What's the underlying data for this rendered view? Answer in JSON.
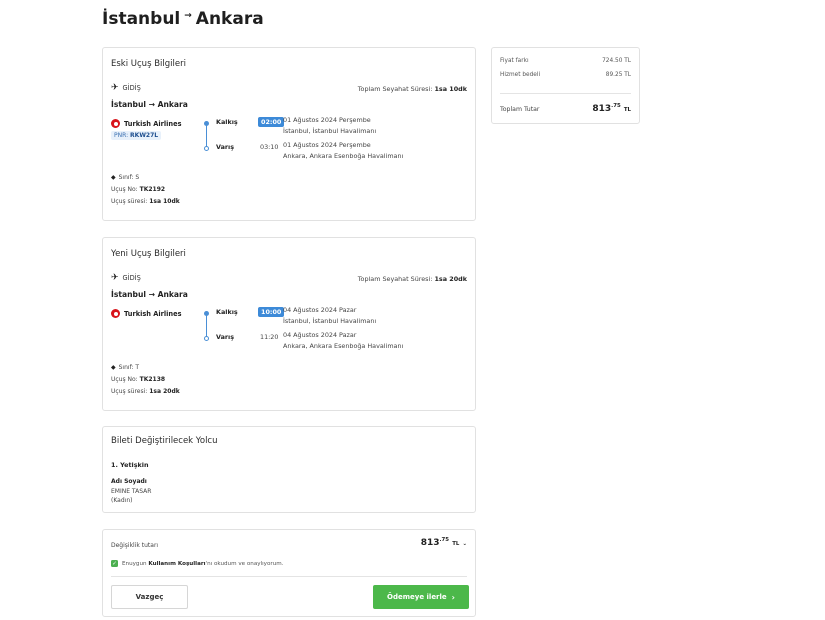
{
  "header": {
    "origin": "İstanbul",
    "arrow": "→",
    "destination": "Ankara"
  },
  "old_flight": {
    "title": "Eski Uçuş Bilgileri",
    "direction": "GİDİŞ",
    "route": "İstanbul → Ankara",
    "total_label": "Toplam Seyahat Süresi:",
    "total_value": "1sa 10dk",
    "airline": "Turkish Airlines",
    "pnr_label": "PNR:",
    "pnr_value": "RKW27L",
    "departure_label": "Kalkış",
    "departure_time": "02:00",
    "departure_date": "01 Ağustos 2024 Perşembe",
    "departure_airport": "İstanbul, İstanbul Havalimanı",
    "arrival_label": "Varış",
    "arrival_time": "03:10",
    "arrival_date": "01 Ağustos 2024 Perşembe",
    "arrival_airport": "Ankara, Ankara Esenboğa Havalimanı",
    "class_text": "Sınıf: S",
    "flight_no_label": "Uçuş No:",
    "flight_no": "TK2192",
    "duration_label": "Uçuş süresi:",
    "duration": "1sa 10dk"
  },
  "new_flight": {
    "title": "Yeni Uçuş Bilgileri",
    "direction": "GİDİŞ",
    "route": "İstanbul → Ankara",
    "total_label": "Toplam Seyahat Süresi:",
    "total_value": "1sa 20dk",
    "airline": "Turkish Airlines",
    "departure_label": "Kalkış",
    "departure_time": "10:00",
    "departure_date": "04 Ağustos 2024 Pazar",
    "departure_airport": "İstanbul, İstanbul Havalimanı",
    "arrival_label": "Varış",
    "arrival_time": "11:20",
    "arrival_date": "04 Ağustos 2024 Pazar",
    "arrival_airport": "Ankara, Ankara Esenboğa Havalimanı",
    "class_text": "Sınıf: T",
    "flight_no_label": "Uçuş No:",
    "flight_no": "TK2138",
    "duration_label": "Uçuş süresi:",
    "duration": "1sa 20dk"
  },
  "passenger": {
    "title": "Bileti Değiştirilecek Yolcu",
    "type": "1. Yetişkin",
    "name_label": "Adı Soyadı",
    "name": "EMINE TASAR",
    "gender": "(Kadın)"
  },
  "summary": {
    "fare_diff_label": "Fiyat farkı",
    "fare_diff_value": "724.50 TL",
    "service_fee_label": "Hizmet bedeli",
    "service_fee_value": "89.25 TL",
    "total_label": "Toplam Tutar",
    "total_int": "813",
    "total_dec": ".75",
    "total_cur": "TL"
  },
  "checkout": {
    "amount_label": "Değişiklik tutarı",
    "amount_int": "813",
    "amount_dec": ".75",
    "amount_cur": "TL",
    "terms_prefix": "Enuygun",
    "terms_link": "Kullanım Koşulları",
    "terms_suffix": "'nı okudum ve onaylıyorum.",
    "cancel_label": "Vazgeç",
    "pay_label": "Ödemeye ilerle"
  },
  "colors": {
    "accent_blue": "#3d8ad8",
    "pay_green": "#4cb84a",
    "brand_red": "#d8141b"
  }
}
